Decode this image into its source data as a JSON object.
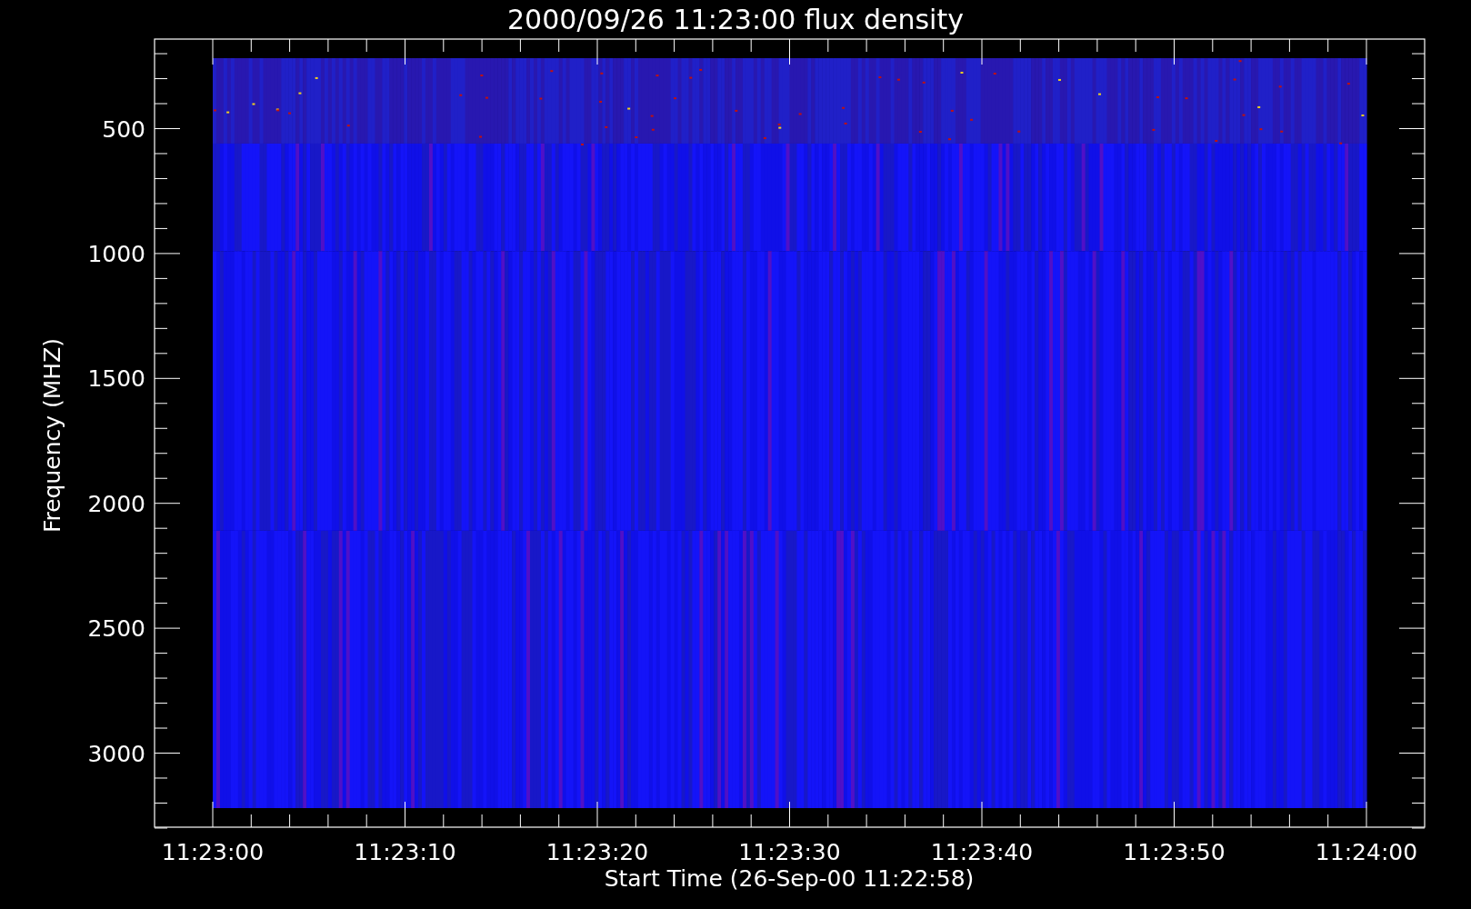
{
  "title": "2000/09/26 11:23:00 flux density",
  "y_axis": {
    "label": "Frequency (MHZ)",
    "ticks": [
      "500",
      "1000",
      "1500",
      "2000",
      "2500",
      "3000"
    ]
  },
  "x_axis": {
    "label": "Start Time (26-Sep-00 11:22:58)",
    "ticks": [
      "11:23:00",
      "11:23:10",
      "11:23:20",
      "11:23:30",
      "11:23:40",
      "11:23:50",
      "11:24:00"
    ]
  }
}
